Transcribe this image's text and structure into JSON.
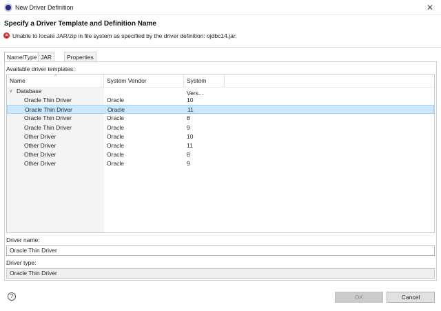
{
  "window": {
    "title": "New Driver Definition",
    "close_glyph": "✕",
    "app_icon": "eclipse-icon"
  },
  "header": {
    "title": "Specify a Driver Template and Definition Name",
    "error_glyph": "×",
    "error_message": "Unable to locate JAR/zip in file system as specified by the driver definition: ojdbc14.jar."
  },
  "tabs": [
    {
      "label": "Name/Type",
      "active": true
    },
    {
      "label": "JAR List",
      "active": false
    },
    {
      "label": "Properties",
      "active": false
    }
  ],
  "templates": {
    "label": "Available driver templates:",
    "sort_glyph": "^",
    "columns": [
      "Name",
      "System Vendor",
      "System Vers..."
    ],
    "group": {
      "expand_glyph": "v",
      "label": "Database"
    },
    "rows": [
      {
        "name": "Oracle Thin Driver",
        "vendor": "Oracle",
        "version": "10",
        "selected": false
      },
      {
        "name": "Oracle Thin Driver",
        "vendor": "Oracle",
        "version": "11",
        "selected": true
      },
      {
        "name": "Oracle Thin Driver",
        "vendor": "Oracle",
        "version": "8",
        "selected": false
      },
      {
        "name": "Oracle Thin Driver",
        "vendor": "Oracle",
        "version": "9",
        "selected": false
      },
      {
        "name": "Other Driver",
        "vendor": "Oracle",
        "version": "10",
        "selected": false
      },
      {
        "name": "Other Driver",
        "vendor": "Oracle",
        "version": "11",
        "selected": false
      },
      {
        "name": "Other Driver",
        "vendor": "Oracle",
        "version": "8",
        "selected": false
      },
      {
        "name": "Other Driver",
        "vendor": "Oracle",
        "version": "9",
        "selected": false
      }
    ]
  },
  "driver_name": {
    "label": "Driver name:",
    "value": "Oracle Thin Driver"
  },
  "driver_type": {
    "label": "Driver type:",
    "value": "Oracle Thin Driver"
  },
  "footer": {
    "help_glyph": "?",
    "ok_label": "OK",
    "cancel_label": "Cancel"
  }
}
